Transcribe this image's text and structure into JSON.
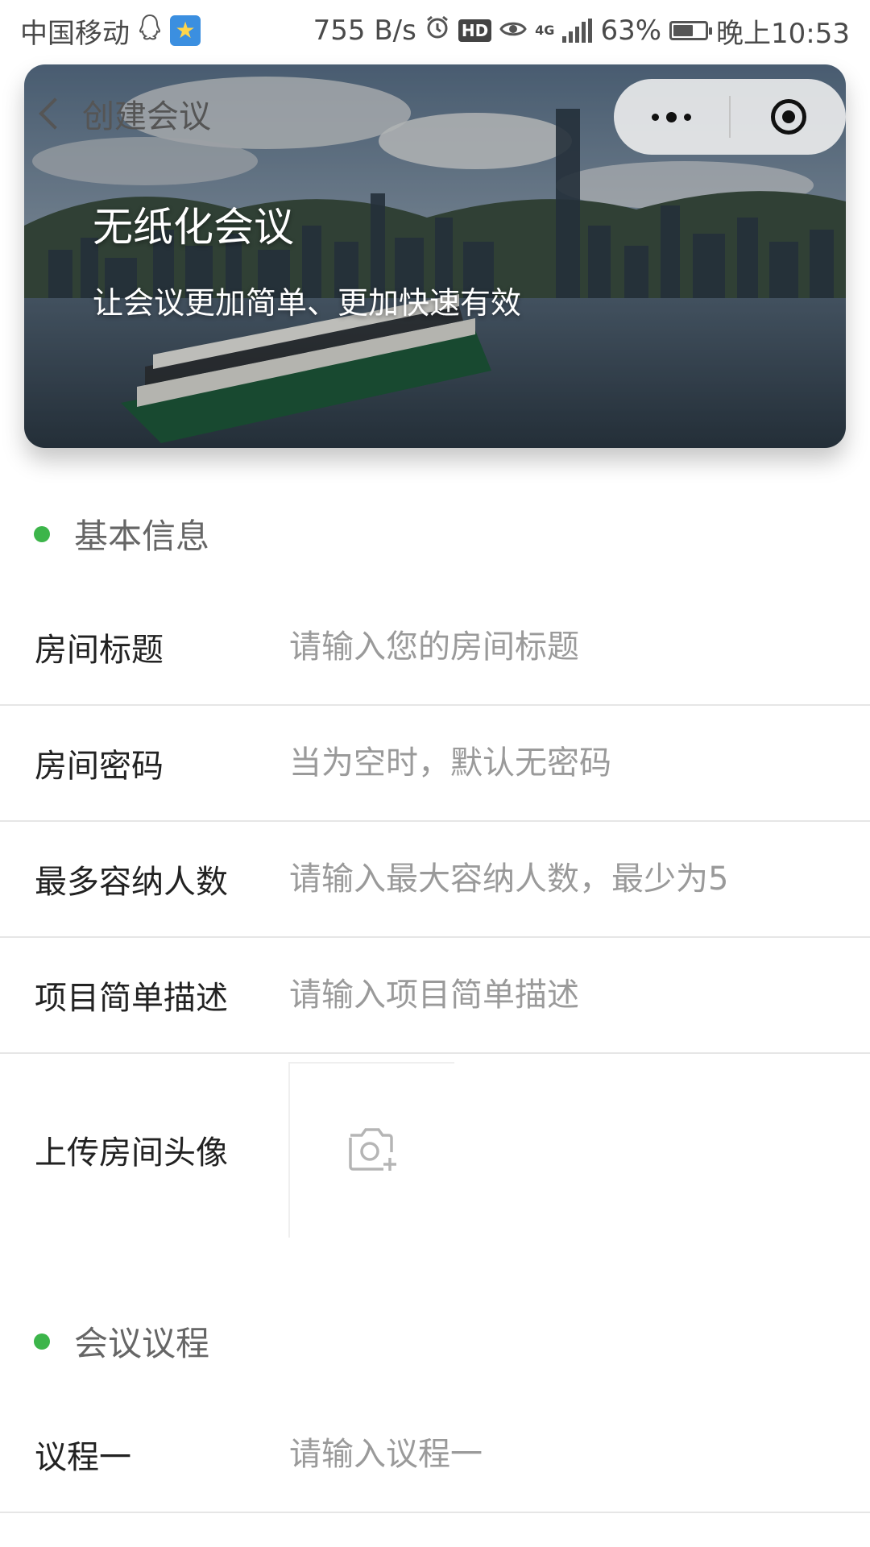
{
  "status_bar": {
    "carrier": "中国移动",
    "speed": "755 B/s",
    "network": "4G",
    "battery": "63%",
    "battery_level": 0.63,
    "time": "晚上10:53"
  },
  "nav": {
    "back_title": "创建会议"
  },
  "banner": {
    "title": "无纸化会议",
    "subtitle": "让会议更加简单、更加快速有效"
  },
  "basic_section": {
    "title": "基本信息",
    "fields": [
      {
        "label": "房间标题",
        "placeholder": "请输入您的房间标题",
        "value": ""
      },
      {
        "label": "房间密码",
        "placeholder": "当为空时，默认无密码",
        "value": ""
      },
      {
        "label": "最多容纳人数",
        "placeholder": "请输入最大容纳人数，最少为5",
        "value": ""
      },
      {
        "label": "项目简单描述",
        "placeholder": "请输入项目简单描述",
        "value": ""
      }
    ],
    "upload_label": "上传房间头像"
  },
  "agenda_section": {
    "title": "会议议程",
    "fields": [
      {
        "label": "议程一",
        "placeholder": "请输入议程一",
        "value": ""
      }
    ]
  },
  "colors": {
    "accent_dot": "#3cb54a",
    "label": "#222222",
    "placeholder": "#9a9a9a"
  },
  "icons": [
    "back-chevron-icon",
    "more-dots-icon",
    "close-target-icon",
    "camera-add-icon",
    "alarm-icon",
    "eye-icon",
    "qq-icon",
    "star-icon"
  ]
}
